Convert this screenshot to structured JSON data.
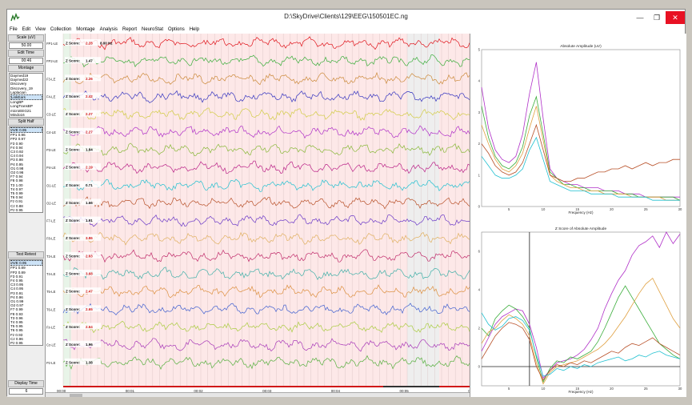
{
  "window": {
    "title": "D:\\SkyDrive\\Clients\\129\\EEG\\150501EC.ng",
    "minimize_glyph": "—",
    "restore_glyph": "❐",
    "close_glyph": "✕"
  },
  "menu": [
    "File",
    "Edit",
    "View",
    "Collection",
    "Montage",
    "Analysis",
    "Report",
    "NeuroStat",
    "Options",
    "Help"
  ],
  "left_panel": {
    "scale_label": "Scale (uV)",
    "scale_value": "50.00",
    "edit_time_label": "Edit Time",
    "edit_time_value": "00:46",
    "montage_label": "Montage",
    "montages": [
      "Daymed19",
      "Daymed22",
      "Discovery",
      "Discovery_19",
      "Laplacian",
      "LinkEars",
      "LongBP",
      "LongTransBP",
      "microEEG21",
      "Mindo16"
    ],
    "montage_selected": "LinkEars",
    "split_half_label": "Split Half",
    "split_half": [
      "AVE 0.95",
      "FP1  0.96",
      "FP2  0.97",
      "F3  0.90",
      "F4  0.94",
      "C3  0.92",
      "C4  0.94",
      "P3  0.98",
      "P4  0.95",
      "O1  0.98",
      "O2  0.96",
      "F7  0.94",
      "F8  0.98",
      "T3  1.00",
      "T4  0.97",
      "T5  0.99",
      "T6  0.94",
      "Fz  0.91",
      "Cz  0.88",
      "Pz  0.95"
    ],
    "test_retest_label": "Test Retest",
    "test_retest": [
      "AVE 0.95",
      "FP1  0.89",
      "FP2  0.89",
      "F3  0.91",
      "F4  0.95",
      "C3  0.95",
      "C4  0.95",
      "P3  0.91",
      "P4  0.96",
      "O1  0.99",
      "O2  0.97",
      "F7  0.99",
      "F8  0.93",
      "T3  0.96",
      "T4  0.95",
      "T5  0.95",
      "T6  0.95",
      "Fz  0.93",
      "Cz  0.96",
      "Pz  0.95"
    ],
    "display_time_label": "Display Time",
    "display_time_value": "6"
  },
  "eeg": {
    "frequency_marker": "8.00 Hz",
    "z_label": "Z Score:",
    "channels": [
      {
        "name": "FP1-LE",
        "z": "2.28",
        "color": "#e0151c"
      },
      {
        "name": "FP2-LE",
        "z": "1.47",
        "color": "#3aad3a"
      },
      {
        "name": "F3-LE",
        "z": "2.26",
        "color": "#cc8a3a"
      },
      {
        "name": "F4-LE",
        "z": "2.42",
        "color": "#3535c0"
      },
      {
        "name": "C3-LE",
        "z": "2.27",
        "color": "#d2cc45"
      },
      {
        "name": "C4-LE",
        "z": "2.27",
        "color": "#b030c8"
      },
      {
        "name": "P3-LE",
        "z": "1.84",
        "color": "#88b838"
      },
      {
        "name": "P4-LE",
        "z": "2.19",
        "color": "#bb2288"
      },
      {
        "name": "O1-LE",
        "z": "0.71",
        "color": "#20c0d0"
      },
      {
        "name": "O2-LE",
        "z": "1.66",
        "color": "#b85028"
      },
      {
        "name": "F7-LE",
        "z": "1.91",
        "color": "#6a38c8"
      },
      {
        "name": "F8-LE",
        "z": "3.86",
        "color": "#e0b060"
      },
      {
        "name": "T3-LE",
        "z": "2.63",
        "color": "#c02a6a"
      },
      {
        "name": "T4-LE",
        "z": "3.68",
        "color": "#40b0a8"
      },
      {
        "name": "T5-LE",
        "z": "2.47",
        "color": "#dd9040"
      },
      {
        "name": "T6-LE",
        "z": "2.65",
        "color": "#4060d0"
      },
      {
        "name": "Fz-LE",
        "z": "2.64",
        "color": "#aacc40"
      },
      {
        "name": "Cz-LE",
        "z": "1.96",
        "color": "#a838b8"
      },
      {
        "name": "Pz-LE",
        "z": "1.38",
        "color": "#58b040"
      }
    ],
    "time_ticks": [
      "00:00",
      "00:01",
      "00:02",
      "00:03",
      "00:04",
      "00:05",
      "00:06"
    ]
  },
  "chart_data": [
    {
      "type": "line",
      "title": "Absolute Amplitude (uV)",
      "xlabel": "Frequency (Hz)",
      "ylabel": "",
      "xlim": [
        1,
        30
      ],
      "ylim": [
        0,
        5
      ],
      "xticks": [
        "5",
        "10",
        "15",
        "20",
        "25",
        "30"
      ],
      "yticks": [
        "0",
        "1",
        "2",
        "3",
        "4",
        "5"
      ],
      "x": [
        1,
        2,
        3,
        4,
        5,
        6,
        7,
        8,
        9,
        10,
        11,
        12,
        13,
        14,
        15,
        16,
        17,
        18,
        19,
        20,
        21,
        22,
        23,
        24,
        25,
        26,
        27,
        28,
        29,
        30
      ],
      "series": [
        {
          "values": [
            3.8,
            2.5,
            1.8,
            1.5,
            1.4,
            1.6,
            2.3,
            3.6,
            4.6,
            2.8,
            1.2,
            0.9,
            0.8,
            0.7,
            0.7,
            0.6,
            0.6,
            0.6,
            0.5,
            0.5,
            0.5,
            0.4,
            0.4,
            0.4,
            0.3,
            0.3,
            0.3,
            0.3,
            0.3,
            0.3
          ]
        },
        {
          "values": [
            3.2,
            2.2,
            1.6,
            1.3,
            1.2,
            1.4,
            1.9,
            2.9,
            3.5,
            2.3,
            1.1,
            0.9,
            0.7,
            0.7,
            0.6,
            0.6,
            0.5,
            0.5,
            0.5,
            0.5,
            0.4,
            0.4,
            0.4,
            0.3,
            0.3,
            0.3,
            0.3,
            0.3,
            0.3,
            0.2
          ]
        },
        {
          "values": [
            2.6,
            2.0,
            1.5,
            1.2,
            1.1,
            1.3,
            1.7,
            2.5,
            3.2,
            2.1,
            1.0,
            0.8,
            0.7,
            0.6,
            0.6,
            0.5,
            0.5,
            0.5,
            0.4,
            0.4,
            0.4,
            0.4,
            0.3,
            0.3,
            0.3,
            0.3,
            0.3,
            0.2,
            0.2,
            0.2
          ]
        },
        {
          "values": [
            2.0,
            1.7,
            1.3,
            1.1,
            1.0,
            1.1,
            1.4,
            2.0,
            2.6,
            1.8,
            1.0,
            0.9,
            0.8,
            0.8,
            0.9,
            0.9,
            1.0,
            1.1,
            1.1,
            1.2,
            1.2,
            1.3,
            1.2,
            1.3,
            1.4,
            1.3,
            1.4,
            1.4,
            1.5,
            1.5
          ]
        },
        {
          "values": [
            1.6,
            1.3,
            1.0,
            0.9,
            0.9,
            1.0,
            1.2,
            1.8,
            2.2,
            1.5,
            0.8,
            0.7,
            0.6,
            0.5,
            0.5,
            0.5,
            0.4,
            0.4,
            0.4,
            0.4,
            0.3,
            0.3,
            0.3,
            0.3,
            0.3,
            0.2,
            0.2,
            0.2,
            0.2,
            0.2
          ]
        }
      ]
    },
    {
      "type": "line",
      "title": "Z Score of Absolute Amplitude",
      "xlabel": "Frequency (Hz)",
      "ylabel": "",
      "xlim": [
        1,
        30
      ],
      "ylim": [
        -1,
        7
      ],
      "xticks": [
        "5",
        "10",
        "15",
        "20",
        "25",
        "30"
      ],
      "yticks": [
        "0",
        "2",
        "4",
        "6"
      ],
      "cursor_hz": 8,
      "x": [
        1,
        2,
        3,
        4,
        5,
        6,
        7,
        8,
        9,
        10,
        11,
        12,
        13,
        14,
        15,
        16,
        17,
        18,
        19,
        20,
        21,
        22,
        23,
        24,
        25,
        26,
        27,
        28,
        29,
        30
      ],
      "series": [
        {
          "values": [
            0.8,
            1.5,
            2.2,
            2.6,
            2.8,
            3.0,
            2.9,
            2.2,
            1.0,
            -0.6,
            -0.2,
            0.2,
            0.3,
            0.4,
            0.6,
            0.9,
            1.4,
            2.0,
            3.0,
            3.8,
            4.5,
            5.0,
            5.8,
            6.3,
            6.5,
            6.8,
            6.2,
            7.0,
            6.4,
            6.9
          ]
        },
        {
          "values": [
            2.0,
            1.6,
            2.5,
            2.9,
            3.2,
            3.0,
            2.6,
            2.0,
            0.5,
            -0.8,
            -0.1,
            0.3,
            0.2,
            0.5,
            0.4,
            0.6,
            0.8,
            1.3,
            2.0,
            2.8,
            3.6,
            4.2,
            3.6,
            3.0,
            2.4,
            1.8,
            1.2,
            0.9,
            0.6,
            0.4
          ]
        },
        {
          "values": [
            1.2,
            1.8,
            2.0,
            2.4,
            2.7,
            2.5,
            2.2,
            1.6,
            0.2,
            -0.9,
            -0.3,
            0.0,
            0.1,
            0.2,
            0.3,
            0.5,
            0.7,
            0.9,
            1.2,
            1.6,
            2.1,
            2.6,
            3.2,
            3.8,
            4.3,
            4.6,
            3.9,
            3.2,
            2.5,
            2.0
          ]
        },
        {
          "values": [
            0.4,
            1.0,
            1.6,
            2.0,
            2.3,
            2.2,
            2.0,
            1.4,
            0.0,
            -0.7,
            -0.2,
            0.1,
            0.0,
            0.2,
            0.1,
            0.3,
            0.2,
            0.4,
            0.6,
            0.8,
            0.7,
            1.0,
            1.2,
            1.1,
            1.3,
            1.5,
            1.2,
            1.0,
            0.8,
            0.6
          ]
        },
        {
          "values": [
            2.8,
            2.2,
            1.9,
            2.1,
            2.5,
            2.6,
            2.4,
            1.9,
            0.6,
            -0.5,
            -0.4,
            -0.1,
            -0.2,
            0.0,
            -0.1,
            0.1,
            0.0,
            0.2,
            0.3,
            0.4,
            0.5,
            0.3,
            0.4,
            0.6,
            0.5,
            0.7,
            0.8,
            0.6,
            0.5,
            0.4
          ]
        }
      ]
    }
  ]
}
